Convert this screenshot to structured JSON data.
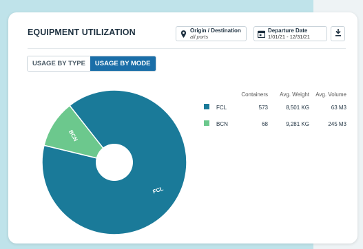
{
  "title": "EQUIPMENT UTILIZATION",
  "filters": {
    "origin_label": "Origin / Destination",
    "origin_value": "all ports",
    "date_label": "Departure Date",
    "date_value": "1/01/21 - 12/31/21"
  },
  "tabs": [
    {
      "label": "USAGE BY TYPE",
      "active": false
    },
    {
      "label": "USAGE BY MODE",
      "active": true
    }
  ],
  "table": {
    "headers": [
      "Containers",
      "Avg. Weight",
      "Avg. Volume"
    ],
    "rows": [
      {
        "name": "FCL",
        "color": "#1a7a99",
        "containers": "573",
        "avg_weight": "8,501 KG",
        "avg_volume": "63 M3"
      },
      {
        "name": "BCN",
        "color": "#6cc88d",
        "containers": "68",
        "avg_weight": "9,281 KG",
        "avg_volume": "245 M3"
      }
    ]
  },
  "chart_data": {
    "type": "pie",
    "donut": true,
    "slices": [
      {
        "label": "FCL",
        "value": 573,
        "color": "#1a7a99"
      },
      {
        "label": "BCN",
        "value": 68,
        "color": "#6cc88d"
      }
    ]
  }
}
